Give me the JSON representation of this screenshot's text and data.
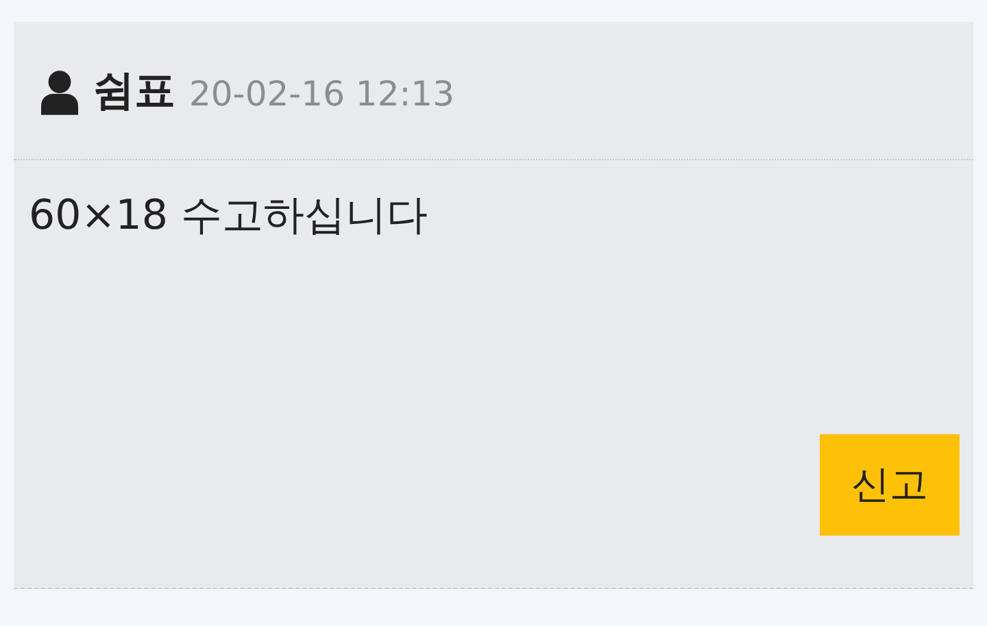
{
  "comment": {
    "author": "쉼표",
    "date": "20-02-16 12:13",
    "text": "60×18 수고하십니다",
    "report_button": "신고"
  }
}
